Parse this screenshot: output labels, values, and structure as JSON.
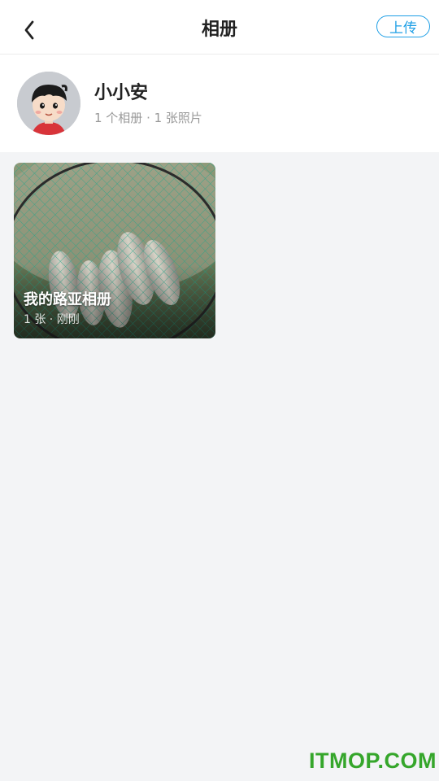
{
  "header": {
    "title": "相册",
    "upload_label": "上传"
  },
  "profile": {
    "name": "小小安",
    "meta": "1 个相册 · 1 张照片"
  },
  "albums": [
    {
      "name": "我的路亚相册",
      "meta": "1 张 · 刚刚"
    }
  ],
  "watermark": "ITMOP.COM",
  "colors": {
    "accent": "#1e9fe6",
    "background": "#f3f4f6",
    "watermark": "#35a62b"
  }
}
